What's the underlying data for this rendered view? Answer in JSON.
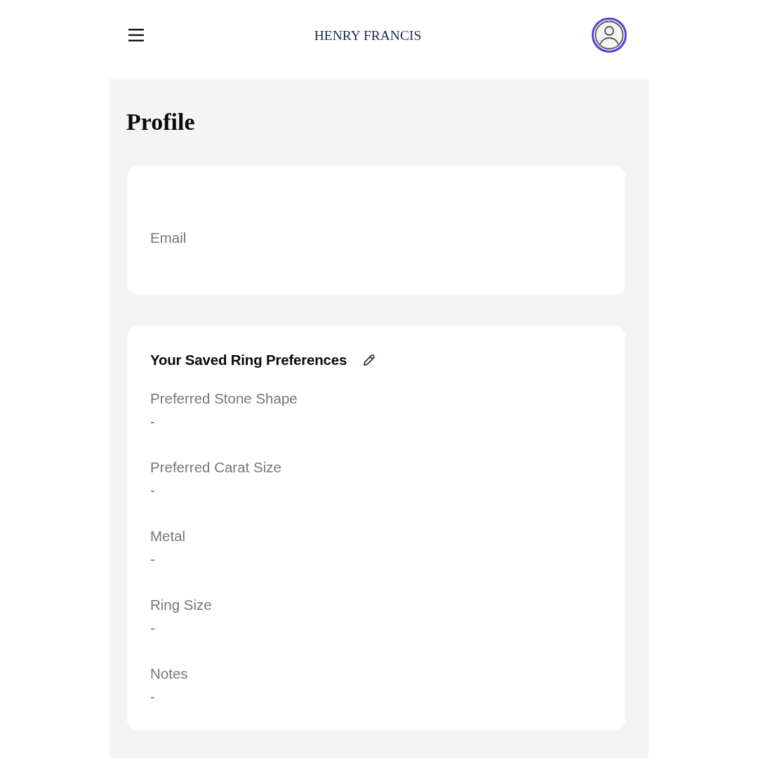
{
  "header": {
    "brand": "HENRY FRANCIS"
  },
  "page": {
    "title": "Profile"
  },
  "account_card": {
    "fields": [
      {
        "label": "Email"
      }
    ]
  },
  "preferences_card": {
    "title": "Your Saved Ring Preferences",
    "fields": [
      {
        "label": "Preferred Stone Shape",
        "value": "-"
      },
      {
        "label": "Preferred Carat Size",
        "value": "-"
      },
      {
        "label": "Metal",
        "value": "-"
      },
      {
        "label": "Ring Size",
        "value": "-"
      },
      {
        "label": "Notes",
        "value": "-"
      }
    ]
  }
}
